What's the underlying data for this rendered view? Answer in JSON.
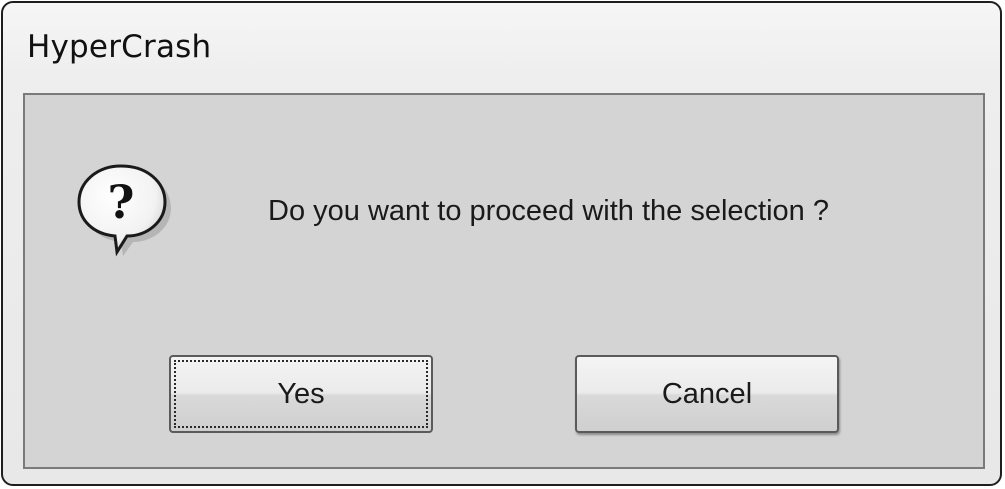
{
  "dialog": {
    "title": "HyperCrash",
    "message": "Do you want to proceed with the selection ?",
    "icon": "question-icon",
    "buttons": {
      "yes_label": "Yes",
      "cancel_label": "Cancel"
    },
    "focused_button": "Yes"
  }
}
